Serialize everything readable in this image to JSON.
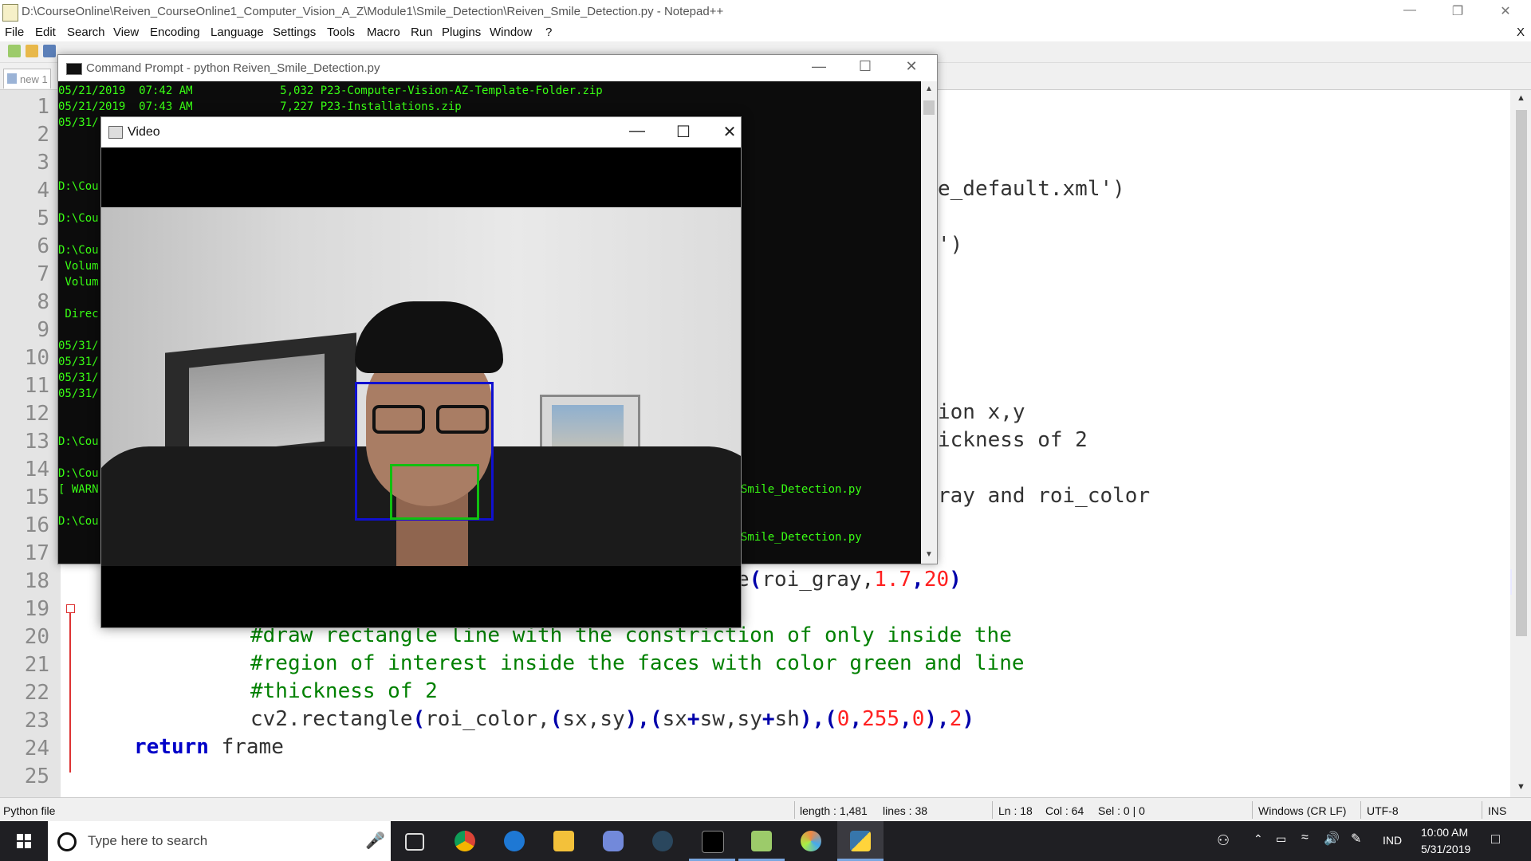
{
  "npp": {
    "title": "D:\\CourseOnline\\Reiven_CourseOnline1_Computer_Vision_A_Z\\Module1\\Smile_Detection\\Reiven_Smile_Detection.py - Notepad++",
    "menu": [
      "File",
      "Edit",
      "Search",
      "View",
      "Encoding",
      "Language",
      "Settings",
      "Tools",
      "Macro",
      "Run",
      "Plugins",
      "Window",
      "?"
    ],
    "close_x": "X",
    "tab_label": "new 1",
    "line_numbers": [
      "1",
      "2",
      "3",
      "4",
      "5",
      "6",
      "7",
      "8",
      "9",
      "10",
      "11",
      "12",
      "13",
      "14",
      "15",
      "16",
      "17",
      "18",
      "19",
      "20",
      "21",
      "22",
      "23",
      "24",
      "25"
    ],
    "visible_code": {
      "l4": "e_default.xml')",
      "l6": "')",
      "l12": "ion x,y",
      "l13": "ickness of 2",
      "l15": "ray and roi_color",
      "l18_a": "e",
      "l18_b": "(",
      "l18_c": "roi_gray,",
      "l18_d": "1.7",
      "l18_e": ",",
      "l18_f": "20",
      "l18_g": ")",
      "l20": "#draw rectangle line with the constriction of only inside the",
      "l21": "#region of interest inside the faces with color green and line",
      "l22": "#thickness of 2",
      "l23_a": "cv2.rectangle",
      "l23_b": "(",
      "l23_c": "roi_color,",
      "l23_d": "(",
      "l23_e": "sx,sy",
      "l23_f": "),(",
      "l23_g": "sx",
      "l23_h": "+",
      "l23_i": "sw,sy",
      "l23_j": "+",
      "l23_k": "sh",
      "l23_l": "),(",
      "l23_m": "0",
      "l23_n": ",",
      "l23_o": "255",
      "l23_p": ",",
      "l23_q": "0",
      "l23_r": "),",
      "l23_s": "2",
      "l23_t": ")",
      "l24_kw": "return",
      "l24_rest": " frame"
    },
    "status": {
      "filetype": "Python file",
      "length": "length : 1,481",
      "lines": "lines : 38",
      "ln": "Ln : 18",
      "col": "Col : 64",
      "sel": "Sel : 0 | 0",
      "eol": "Windows (CR LF)",
      "encoding": "UTF-8",
      "mode": "INS"
    }
  },
  "cmd": {
    "title": "Command Prompt - python  Reiven_Smile_Detection.py",
    "lines": [
      "05/21/2019  07:42 AM             5,032 P23-Computer-Vision-AZ-Template-Folder.zip",
      "05/21/2019  07:43 AM             7,227 P23-Installations.zip",
      "05/31/",
      "D:\\Cou",
      "D:\\Cou",
      "D:\\Cou",
      " Volum",
      " Volum",
      " Direc",
      "05/31/",
      "05/31/",
      "05/31/",
      "05/31/",
      "D:\\Cou",
      "D:\\Cou",
      "[ WARN",
      "D:\\Cou"
    ],
    "right_1": "Smile_Detection.py",
    "right_2": "Smile_Detection.py"
  },
  "video": {
    "title": "Video"
  },
  "taskbar": {
    "search_placeholder": "Type here to search",
    "lang": "IND",
    "time": "10:00 AM",
    "date": "5/31/2019"
  },
  "colors": {
    "face_box": "#1010d0",
    "smile_box": "#10c010",
    "console_text": "#39ff14",
    "keyword": "#0000c8",
    "comment": "#008000",
    "number": "#ff2020"
  }
}
